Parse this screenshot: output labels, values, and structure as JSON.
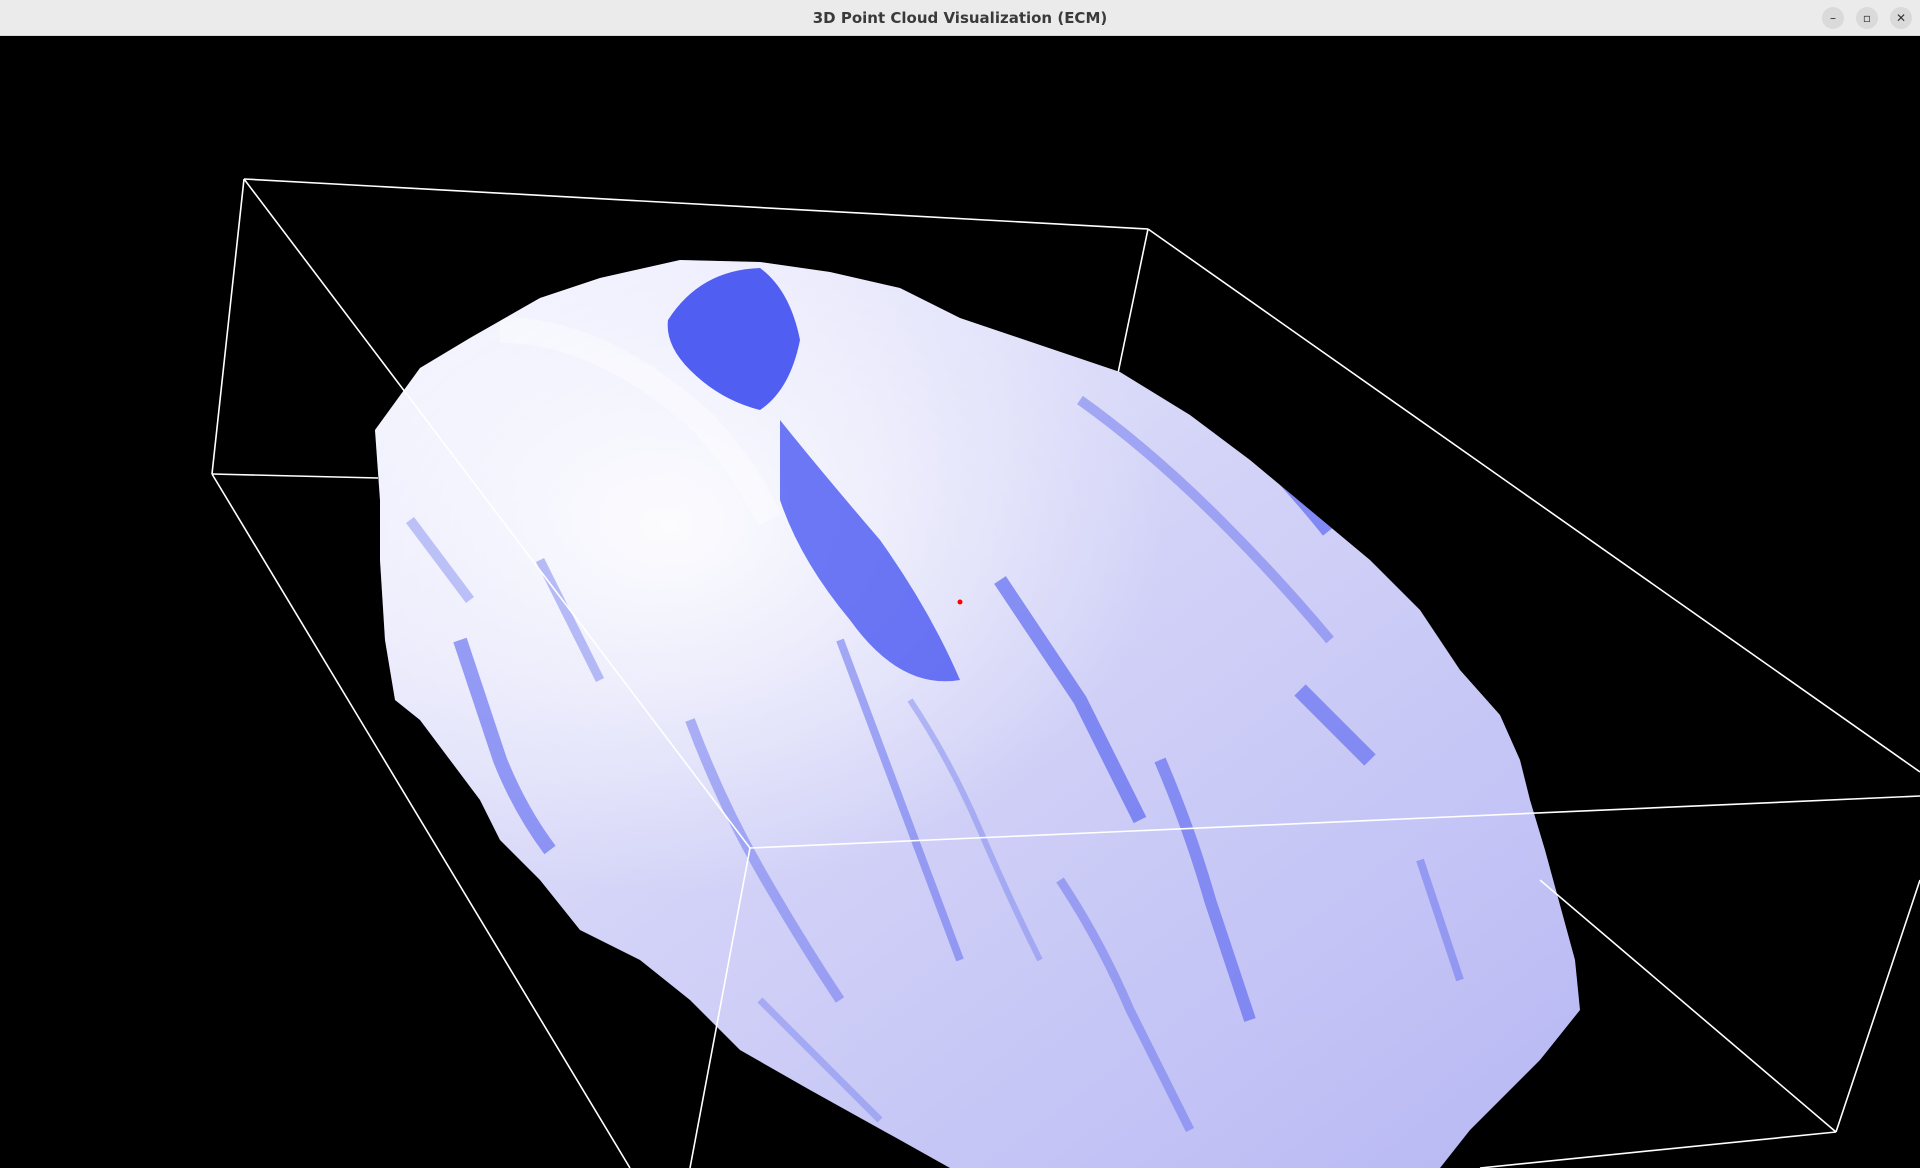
{
  "window": {
    "title": "3D Point Cloud Visualization (ECM)",
    "controls": {
      "minimize_glyph": "–",
      "maximize_glyph": "▫",
      "close_glyph": "✕"
    }
  },
  "viewport": {
    "background_color": "#000000",
    "bounding_box_color": "#ffffff",
    "center_marker_color": "#ff0000",
    "point_colors": {
      "highlight": "#f4f4ff",
      "mid": "#b8b8f4",
      "shadow": "#3e4ef0"
    }
  }
}
